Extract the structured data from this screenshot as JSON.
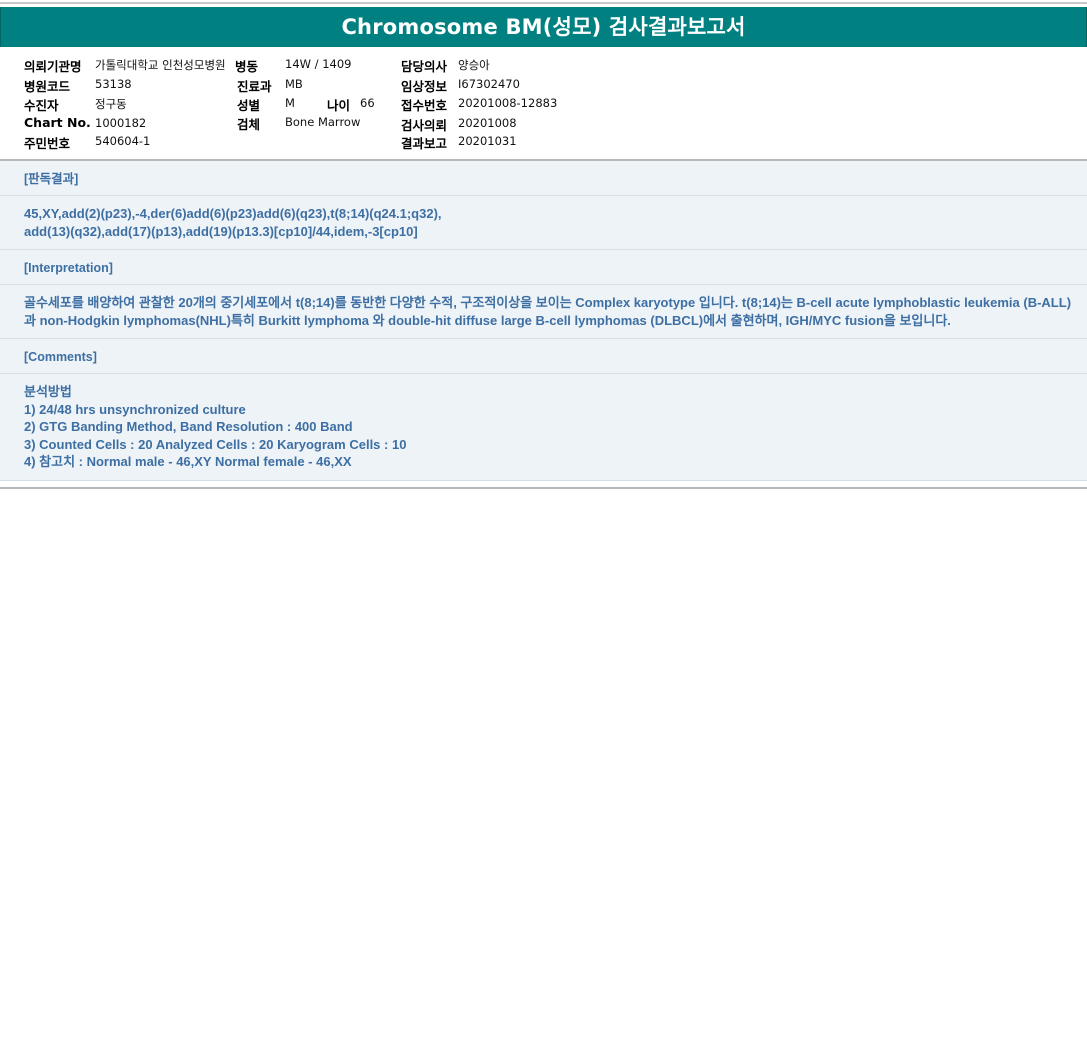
{
  "title": "Chromosome BM(성모) 검사결과보고서",
  "info": {
    "institution_label": "의뢰기관명",
    "institution_value": "가톨릭대학교 인천성모병원",
    "hospital_code_label": "병원코드",
    "hospital_code_value": "53138",
    "patient_label": "수진자",
    "patient_value": "정구동",
    "chart_label": "Chart No.",
    "chart_value": "1000182",
    "resident_label": "주민번호",
    "resident_value": "540604-1",
    "ward_label": "병동",
    "ward_value": "14W / 1409",
    "dept_label": "진료과",
    "dept_value": "MB",
    "sex_label": "성별",
    "sex_value": "M",
    "age_label": "나이",
    "age_value": "66",
    "specimen_label": "검체",
    "specimen_value": "Bone Marrow",
    "doctor_label": "담당의사",
    "doctor_value": "양승아",
    "clinical_label": "임상정보",
    "clinical_value": "I67302470",
    "receipt_label": "접수번호",
    "receipt_value": "20201008-12883",
    "request_label": "검사의뢰",
    "request_value": "20201008",
    "report_label": "결과보고",
    "report_value": "20201031"
  },
  "result": {
    "heading": "[판독결과]",
    "line1": "45,XY,add(2)(p23),-4,der(6)add(6)(p23)add(6)(q23),t(8;14)(q24.1;q32),",
    "line2": "add(13)(q32),add(17)(p13),add(19)(p13.3)[cp10]/44,idem,-3[cp10]"
  },
  "interpretation": {
    "heading": "[Interpretation]",
    "line1": "골수세포를 배양하여 관찰한 20개의 중기세포에서 t(8;14)를 동반한 다양한 수적, 구조적이상을 보이는 Complex karyotype 입니다. t(8;14)는 B-cell acute lymphoblastic leukemia (B-ALL)",
    "line2": "과 non-Hodgkin lymphomas(NHL)특히 Burkitt lymphoma 와 double-hit diffuse large B-cell lymphomas (DLBCL)에서 출현하며, IGH/MYC fusion을 보입니다."
  },
  "comments": {
    "heading": "[Comments]",
    "method_title": "분석방법",
    "items": [
      "1) 24/48 hrs unsynchronized culture",
      "2) GTG Banding Method, Band Resolution : 400 Band",
      "3) Counted Cells : 20 Analyzed Cells : 20 Karyogram Cells : 10",
      "4) 참고치 : Normal male - 46,XY Normal female - 46,XX"
    ]
  },
  "colors": {
    "title_bg": "#008080",
    "section_text": "#3d6fa3",
    "section_bg": "#eef3f8"
  }
}
